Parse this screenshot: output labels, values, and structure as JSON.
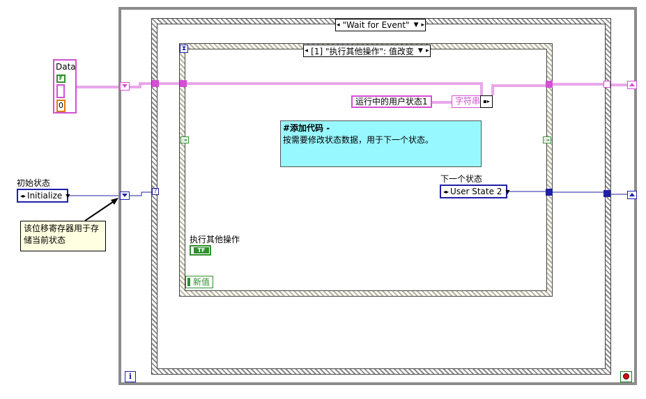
{
  "event_structure": {
    "selector_label": "\"Wait for Event\""
  },
  "case_structure": {
    "selector_label": "[1] \"执行其他操作\": 值改变"
  },
  "cluster_control": {
    "label": "Data",
    "boolean_text": "F",
    "numeric_value": "0"
  },
  "initial_state": {
    "label": "初始状态",
    "value": "Initialize"
  },
  "note": {
    "text_line1": "该位移寄存器用于存",
    "text_line2": "储当前状态"
  },
  "comment": {
    "title": "#添加代码 -",
    "body": "按需要修改状态数据，用于下一个状态。"
  },
  "string_constant": {
    "value": "运行中的用户状态1",
    "type_label": "字符串"
  },
  "next_state": {
    "label": "下一个状态",
    "value": "User State 2"
  },
  "other_action": {
    "label": "执行其他操作",
    "boolean_text": "TF"
  },
  "new_value": {
    "label": "新值"
  },
  "iteration_terminal": {
    "text": "i"
  },
  "colors": {
    "string_wire": "#d34fd3",
    "enum_wire": "#1f1fa8",
    "comment_bg": "#98f8ff",
    "note_bg": "#ffffe1",
    "loop_border": "#8c8c8c"
  }
}
